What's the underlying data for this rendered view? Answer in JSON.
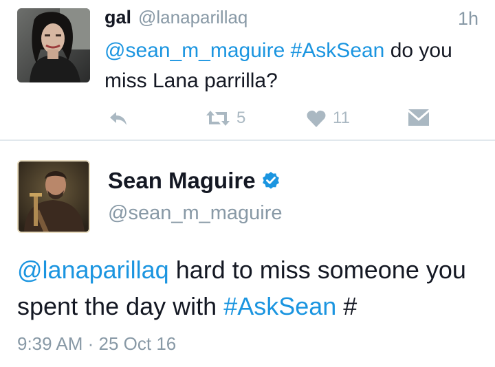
{
  "reply_tweet": {
    "display_name": "gal",
    "handle": "@lanaparillaq",
    "time": "1h",
    "mention": "@sean_m_maguire",
    "hashtag": "#AskSean",
    "text_rest": " do you miss Lana parrilla?",
    "actions": {
      "reply_icon": "reply-icon",
      "retweet_icon": "retweet-icon",
      "retweet_count": "5",
      "like_icon": "heart-icon",
      "like_count": "11",
      "dm_icon": "direct-message-icon"
    }
  },
  "main_tweet": {
    "display_name": "Sean Maguire",
    "verified_icon": "verified-badge-icon",
    "handle": "@sean_m_maguire",
    "mention": "@lanaparillaq",
    "text_mid": " hard to miss someone you spent the day with ",
    "hashtag": "#AskSean",
    "text_end": " #",
    "time": "9:39 AM",
    "separator": " · ",
    "date": "25 Oct 16"
  },
  "colors": {
    "link": "#1b95e0",
    "muted": "#8899a6",
    "icon": "#aab8c2",
    "text": "#141823",
    "divider": "#e1e8ed"
  }
}
